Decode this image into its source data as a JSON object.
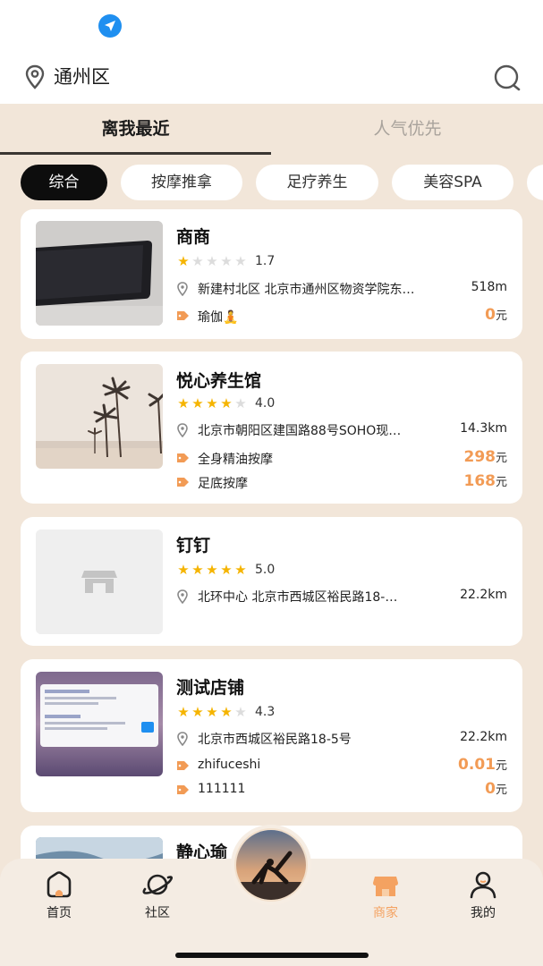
{
  "header": {
    "location": "通州区",
    "location_arrow_icon": "navigation-arrow-icon",
    "search_icon": "search-icon"
  },
  "tabs": [
    {
      "label": "离我最近",
      "active": true
    },
    {
      "label": "人气优先",
      "active": false
    }
  ],
  "chips": [
    {
      "label": "综合",
      "active": true
    },
    {
      "label": "按摩推拿",
      "active": false
    },
    {
      "label": "足疗养生",
      "active": false
    },
    {
      "label": "美容SPA",
      "active": false
    }
  ],
  "shops": [
    {
      "name": "商商",
      "rating": 1.7,
      "rating_text": "1.7",
      "stars_filled": 1,
      "address": "新建村北区 北京市通州区物资学院东…",
      "distance": "518m",
      "services": [
        {
          "name": "瑜伽🧘",
          "price": "0",
          "unit": "元"
        }
      ]
    },
    {
      "name": "悦心养生馆",
      "rating": 4.0,
      "rating_text": "4.0",
      "stars_filled": 4,
      "address": "北京市朝阳区建国路88号SOHO现…",
      "distance": "14.3km",
      "services": [
        {
          "name": "全身精油按摩",
          "price": "298",
          "unit": "元"
        },
        {
          "name": "足底按摩",
          "price": "168",
          "unit": "元"
        }
      ]
    },
    {
      "name": "钉钉",
      "rating": 5.0,
      "rating_text": "5.0",
      "stars_filled": 5,
      "address": "北环中心 北京市西城区裕民路18-…",
      "distance": "22.2km",
      "services": []
    },
    {
      "name": "测试店铺",
      "rating": 4.3,
      "rating_text": "4.3",
      "stars_filled": 4,
      "address": "北京市西城区裕民路18-5号",
      "distance": "22.2km",
      "services": [
        {
          "name": "zhifuceshi",
          "price": "0.01",
          "unit": "元"
        },
        {
          "name": "111111",
          "price": "0",
          "unit": "元"
        }
      ]
    },
    {
      "name": "静心瑜",
      "partial": true
    }
  ],
  "nav": [
    {
      "label": "首页",
      "icon": "home-icon",
      "active": false
    },
    {
      "label": "社区",
      "icon": "planet-icon",
      "active": false
    },
    {
      "label": "商家",
      "icon": "shop-icon",
      "active": true
    },
    {
      "label": "我的",
      "icon": "profile-icon",
      "active": false
    }
  ],
  "colors": {
    "background": "#f2e6d9",
    "accent_price": "#f29b55",
    "star": "#f5b400",
    "nav_active": "#f4a261",
    "chip_active": "#0d0d0d"
  }
}
